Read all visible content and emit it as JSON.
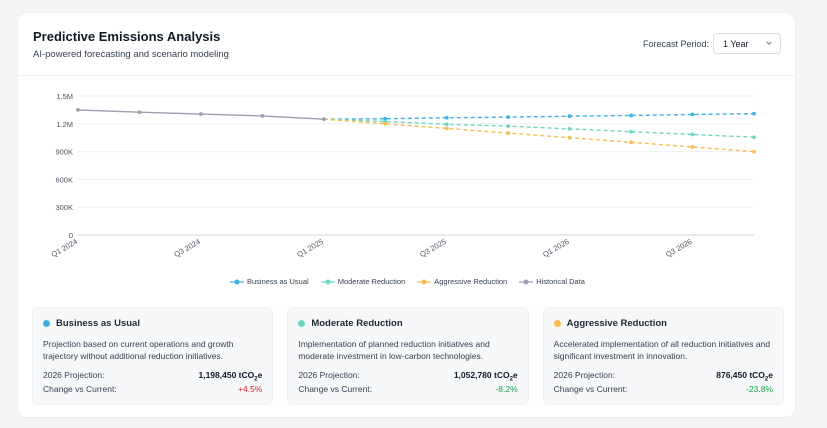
{
  "header": {
    "title": "Predictive Emissions Analysis",
    "subtitle": "AI-powered forecasting and scenario modeling",
    "period_label": "Forecast Period:",
    "period_value": "1 Year"
  },
  "chart_data": {
    "type": "line",
    "x_ticks": [
      "Q1 2024",
      "Q3 2024",
      "Q1 2025",
      "Q3 2025",
      "Q1 2026",
      "Q3 2026"
    ],
    "y_ticks": [
      "1.5M",
      "1.2M",
      "900K",
      "600K",
      "300K",
      "0"
    ],
    "ylim": [
      0,
      1500000
    ],
    "grid": true,
    "legend_position": "bottom",
    "series": [
      {
        "name": "Business as Usual",
        "color": "#3db3e3",
        "dashed": true,
        "points": [
          [
            "Q1 2025",
            1250000
          ],
          [
            "Q2 2025",
            1255000
          ],
          [
            "Q3 2025",
            1265000
          ],
          [
            "Q4 2025",
            1272000
          ],
          [
            "Q1 2026",
            1282000
          ],
          [
            "Q2 2026",
            1290000
          ],
          [
            "Q3 2026",
            1300000
          ],
          [
            "Q4 2026",
            1310000
          ]
        ]
      },
      {
        "name": "Moderate Reduction",
        "color": "#6fd6c2",
        "dashed": true,
        "points": [
          [
            "Q1 2025",
            1250000
          ],
          [
            "Q2 2025",
            1225000
          ],
          [
            "Q3 2025",
            1195000
          ],
          [
            "Q4 2025",
            1175000
          ],
          [
            "Q1 2026",
            1145000
          ],
          [
            "Q2 2026",
            1115000
          ],
          [
            "Q3 2026",
            1085000
          ],
          [
            "Q4 2026",
            1055000
          ]
        ]
      },
      {
        "name": "Aggressive Reduction",
        "color": "#f7be4f",
        "dashed": true,
        "points": [
          [
            "Q1 2025",
            1250000
          ],
          [
            "Q2 2025",
            1200000
          ],
          [
            "Q3 2025",
            1150000
          ],
          [
            "Q4 2025",
            1100000
          ],
          [
            "Q1 2026",
            1050000
          ],
          [
            "Q2 2026",
            1000000
          ],
          [
            "Q3 2026",
            950000
          ],
          [
            "Q4 2026",
            900000
          ]
        ]
      },
      {
        "name": "Historical Data",
        "color": "#9ba1ad",
        "dashed": false,
        "points": [
          [
            "Q1 2024",
            1350000
          ],
          [
            "Q2 2024",
            1325000
          ],
          [
            "Q3 2024",
            1305000
          ],
          [
            "Q4 2024",
            1285000
          ],
          [
            "Q1 2025",
            1250000
          ]
        ]
      }
    ]
  },
  "scenarios": [
    {
      "name": "Business as Usual",
      "color": "#3db3e3",
      "description": "Projection based on current operations and growth trajectory without additional reduction initiatives.",
      "projection_label": "2026 Projection:",
      "projection_value": "1,198,450 tCO",
      "unit_sub": "2",
      "unit_suffix": "e",
      "change_label": "Change vs Current:",
      "change_value": "+4.5%",
      "change_color": "#dc2626"
    },
    {
      "name": "Moderate Reduction",
      "color": "#6fd6c2",
      "description": "Implementation of planned reduction initiatives and moderate investment in low-carbon technologies.",
      "projection_label": "2026 Projection:",
      "projection_value": "1,052,780 tCO",
      "unit_sub": "2",
      "unit_suffix": "e",
      "change_label": "Change vs Current:",
      "change_value": "-8.2%",
      "change_color": "#16a34a"
    },
    {
      "name": "Aggressive Reduction",
      "color": "#f7be4f",
      "description": "Accelerated implementation of all reduction initiatives and significant investment in innovation.",
      "projection_label": "2026 Projection:",
      "projection_value": "876,450 tCO",
      "unit_sub": "2",
      "unit_suffix": "e",
      "change_label": "Change vs Current:",
      "change_value": "-23.8%",
      "change_color": "#16a34a"
    }
  ]
}
